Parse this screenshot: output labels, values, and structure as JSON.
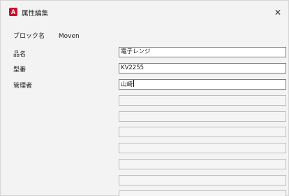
{
  "window": {
    "title": "属性編集",
    "app_icon": "A",
    "close_glyph": "✕"
  },
  "block": {
    "label": "ブロック名",
    "value": "Moven"
  },
  "attributes": [
    {
      "label": "品名",
      "value": "電子レンジ"
    },
    {
      "label": "型番",
      "value": "KV2255"
    },
    {
      "label": "管理者",
      "value": "山崎"
    }
  ],
  "colors": {
    "accent": "#c8102e"
  }
}
